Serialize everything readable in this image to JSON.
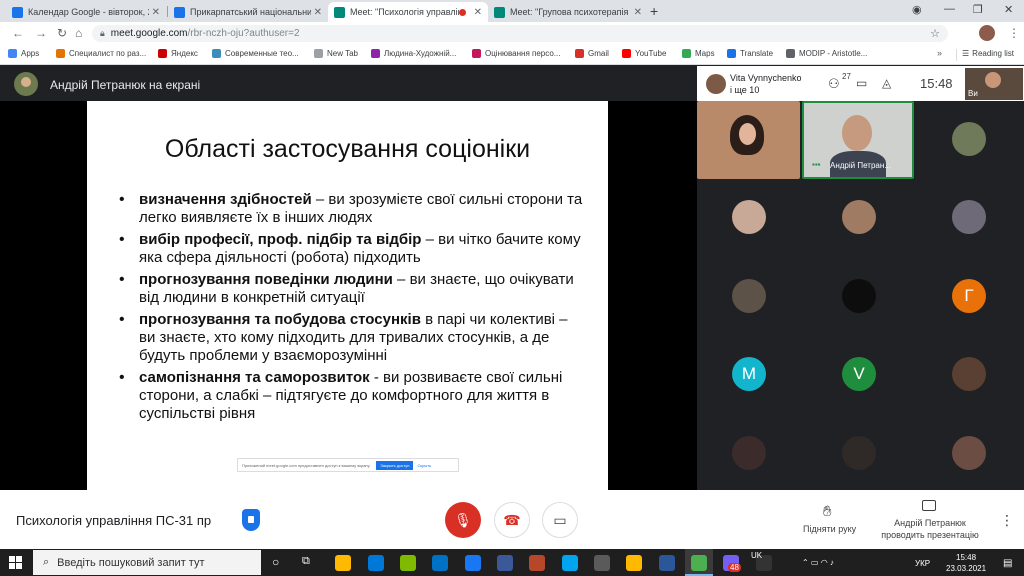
{
  "browser": {
    "tabs": [
      {
        "title": "Календар Google - вівторок, 23",
        "favicon_color": "#1a73e8",
        "active": false
      },
      {
        "title": "Прикарпатський національний",
        "favicon_color": "#1a73e8",
        "active": false
      },
      {
        "title": "Meet: \"Психологія управлін",
        "favicon_color": "#00897b",
        "active": true
      },
      {
        "title": "Meet: \"Групова психотерапія П(",
        "favicon_color": "#00897b",
        "active": false
      }
    ],
    "url_host": "meet.google.com",
    "url_path": "/rbr-nczh-oju?authuser=2",
    "bookmarks": [
      {
        "label": "Apps",
        "color": "#4285f4"
      },
      {
        "label": "Специалист по раз...",
        "color": "#e37400"
      },
      {
        "label": "Яндекс",
        "color": "#cc0000"
      },
      {
        "label": "Современные тео...",
        "color": "#3c8dbc"
      },
      {
        "label": "New Tab",
        "color": "#9aa0a6"
      },
      {
        "label": "Людина-Художній...",
        "color": "#8e24aa"
      },
      {
        "label": "Оцінювання персо...",
        "color": "#c2185b"
      },
      {
        "label": "Gmail",
        "color": "#d93025"
      },
      {
        "label": "YouTube",
        "color": "#ff0000"
      },
      {
        "label": "Maps",
        "color": "#34a853"
      },
      {
        "label": "Translate",
        "color": "#1a73e8"
      },
      {
        "label": "MODIP - Aristotle...",
        "color": "#5f6368"
      }
    ],
    "reading_list": "Reading list"
  },
  "meet": {
    "presenting_label": "Андрій Петранюк на екрані",
    "header_name_line1": "Vita Vynnychenko",
    "header_name_line2": "і ще 10",
    "people_count": "27",
    "time": "15:48",
    "self_label": "Ви",
    "speaking_tile_label": "Андрій Петран...",
    "meeting_title": "Психологія управління ПС-31 пр",
    "raise_hand_label": "Підняти руку",
    "presenter_label": "Андрій Петранюк проводить презентацію",
    "letter_tiles": [
      "Г",
      "M",
      "V"
    ]
  },
  "slide": {
    "title": "Області застосування соціоніки",
    "bullets": [
      {
        "bold": "визначення здібностей",
        "rest": " – ви зрозумієте свої сильні сторони та легко виявляєте їх в інших людях"
      },
      {
        "bold": "вибір професії, проф. підбір та відбір",
        "rest": " – ви чітко бачите кому яка сфера діяльності (робота) підходить"
      },
      {
        "bold": "прогнозування поведінки людини",
        "rest": " – ви знаєте, що очікувати від людини в конкретній ситуації"
      },
      {
        "bold": "прогнозування та побудова стосунків",
        "rest": " в парі чи колективі – ви знаєте, хто кому підходить для тривалих стосунків, а де будуть проблеми у взаєморозумінні"
      },
      {
        "bold": "самопізнання та саморозвиток",
        "rest": " - ви розвиваєте свої сильні сторони, а слабкі – підтягуєте до комфортного для життя в суспільстві рівня"
      }
    ],
    "share_notice": "Прихожений meet.google.com предоставлен доступ к вашему экрану.",
    "share_stop": "Закрыть доступ",
    "share_hide": "Скрыть"
  },
  "taskbar": {
    "search_placeholder": "Введіть пошуковий запит тут",
    "badge_count": "48",
    "lang_top": "UK",
    "lang": "УКР",
    "clock_time": "15:48",
    "clock_date": "23.03.2021"
  },
  "colors": {
    "meet_dark": "#202124",
    "hangup_red": "#d93025",
    "active_speaker_green": "#1e8e3e",
    "letter_g": "#e8710a",
    "letter_m": "#12b5cb",
    "letter_v": "#1e8e3e"
  }
}
